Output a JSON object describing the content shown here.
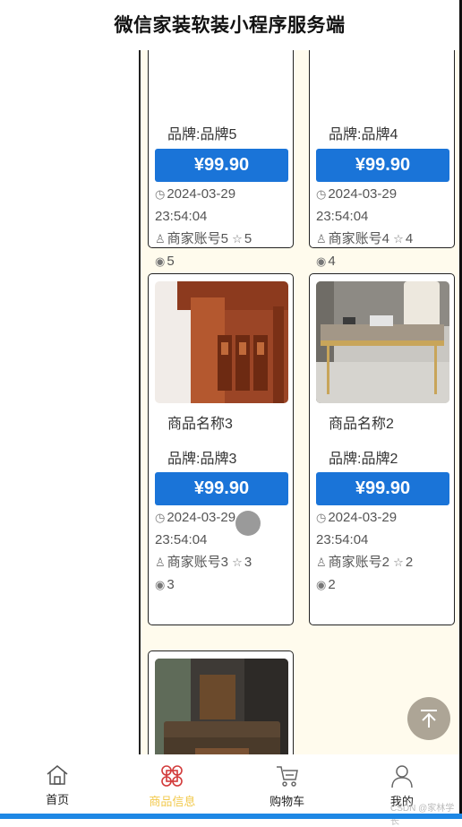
{
  "header": {
    "title": "微信家装软装小程序服务端"
  },
  "products": [
    {
      "name": "",
      "brand": "品牌:品牌5",
      "price": "¥99.90",
      "date": "2024-03-29",
      "time": "23:54:04",
      "merchant": "商家账号5",
      "stars": "5",
      "views": "5"
    },
    {
      "name": "",
      "brand": "品牌:品牌4",
      "price": "¥99.90",
      "date": "2024-03-29",
      "time": "23:54:04",
      "merchant": "商家账号4",
      "stars": "4",
      "views": "4"
    },
    {
      "name": "商品名称3",
      "brand": "品牌:品牌3",
      "price": "¥99.90",
      "date": "2024-03-29",
      "time": "23:54:04",
      "merchant": "商家账号3",
      "stars": "3",
      "views": "3"
    },
    {
      "name": "商品名称2",
      "brand": "品牌:品牌2",
      "price": "¥99.90",
      "date": "2024-03-29",
      "time": "23:54:04",
      "merchant": "商家账号2",
      "stars": "2",
      "views": "2"
    }
  ],
  "icons": {
    "clock": "clock-icon",
    "user": "user-icon",
    "star": "star-icon",
    "eye": "eye-icon",
    "back_to_top": "arrow-up-icon"
  },
  "tabbar": {
    "items": [
      {
        "label": "首页",
        "icon": "home-icon",
        "active": false
      },
      {
        "label": "商品信息",
        "icon": "command-icon",
        "active": true
      },
      {
        "label": "购物车",
        "icon": "cart-icon",
        "active": false
      },
      {
        "label": "我的",
        "icon": "person-icon",
        "active": false
      }
    ]
  },
  "colors": {
    "accent": "#1a74d8",
    "active_tab": "#f2c94c",
    "active_icon": "#d23b3b",
    "content_bg": "#fffbed"
  },
  "watermark": "CSDN @家林学长"
}
